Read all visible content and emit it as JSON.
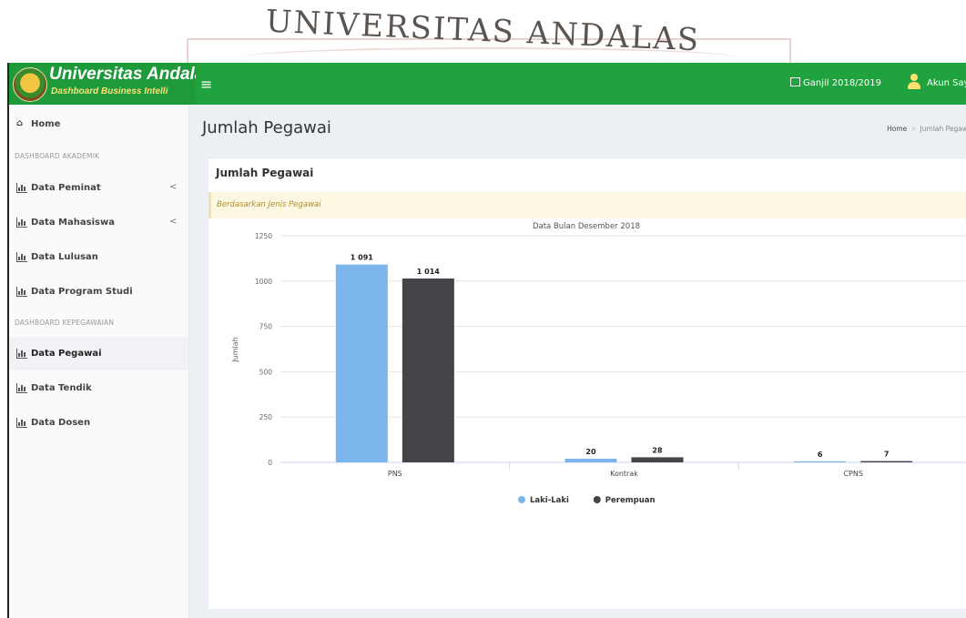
{
  "watermark": {
    "text": "UNIVERSITAS ANDALAS"
  },
  "header": {
    "brand_title": "Universitas Andala",
    "brand_subtitle": "Dashboard Business Intelli",
    "menu_icon": "hamburger-icon",
    "semester": "Ganjil 2018/2019",
    "account": "Akun Say"
  },
  "sidebar": {
    "home": "Home",
    "section_akademik": "DASHBOARD AKADEMIK",
    "section_kepegawaian": "DASHBOARD KEPEGAWAIAN",
    "items": [
      {
        "label": "Data Peminat",
        "expandable": true
      },
      {
        "label": "Data Mahasiswa",
        "expandable": true
      },
      {
        "label": "Data Lulusan",
        "expandable": false
      },
      {
        "label": "Data Program Studi",
        "expandable": false
      },
      {
        "label": "Data Pegawai",
        "expandable": false,
        "active": true
      },
      {
        "label": "Data Tendik",
        "expandable": false
      },
      {
        "label": "Data Dosen",
        "expandable": false
      }
    ],
    "chevron": "<"
  },
  "page": {
    "title": "Jumlah Pegawai",
    "breadcrumb": [
      "Home",
      "Jumlah Pegaw"
    ],
    "box_title": "Jumlah Pegawai",
    "callout": "Berdasarkan Jenis Pegawai"
  },
  "colors": {
    "header_green": "#20a33f",
    "series_laki": "#7cb5ec",
    "series_perempuan": "#434348"
  },
  "chart_data": {
    "type": "bar",
    "title": "Data Bulan Desember 2018",
    "ylabel": "Jumlah",
    "xlabel": "",
    "ylim": [
      0,
      1250
    ],
    "yticks": [
      0,
      250,
      500,
      750,
      1000,
      1250
    ],
    "categories": [
      "PNS",
      "Kontrak",
      "CPNS"
    ],
    "series": [
      {
        "name": "Laki-Laki",
        "values": [
          1091,
          20,
          6
        ],
        "labels": [
          "1 091",
          "20",
          "6"
        ],
        "color": "#7cb5ec"
      },
      {
        "name": "Perempuan",
        "values": [
          1014,
          28,
          7
        ],
        "labels": [
          "1 014",
          "28",
          "7"
        ],
        "color": "#434348"
      }
    ],
    "legend": "bottom"
  }
}
